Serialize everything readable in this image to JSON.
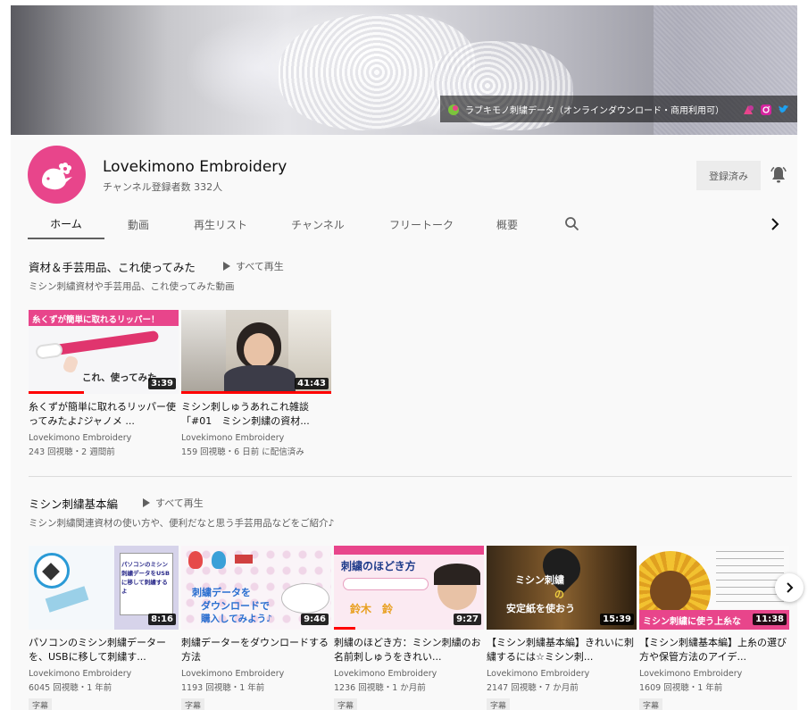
{
  "banner": {
    "link_text": "ラブキモノ刺繍データ（オンラインダウンロード・商用利用可）"
  },
  "channel": {
    "name": "Lovekimono Embroidery",
    "subscribers": "チャンネル登録者数 332人",
    "subscribe_label": "登録済み",
    "avatar_color": "#e8458b"
  },
  "tabs": [
    {
      "label": "ホーム"
    },
    {
      "label": "動画"
    },
    {
      "label": "再生リスト"
    },
    {
      "label": "チャンネル"
    },
    {
      "label": "フリートーク"
    },
    {
      "label": "概要"
    }
  ],
  "sections": [
    {
      "title": "資材＆手芸用品、これ使ってみた",
      "play_all": "すべて再生",
      "description": "ミシン刺繍資材や手芸用品、これ使ってみた動画",
      "videos": [
        {
          "thumb_text": "糸くずが簡単に取れるリッパー！",
          "thumb_text2": "これ、使ってみた",
          "duration": "3:39",
          "progress": 0.37,
          "title": "糸くずが簡単に取れるリッパー使ってみたよ♪ジャノメ ...",
          "channel": "Lovekimono Embroidery",
          "meta": "243 回視聴・2 週間前"
        },
        {
          "duration": "41:43",
          "progress": 1.0,
          "title": "ミシン刺しゅうあれこれ雑談「#01　ミシン刺繍の資材...",
          "channel": "Lovekimono Embroidery",
          "meta": "159 回視聴・6 日前 に配信済み"
        }
      ]
    },
    {
      "title": "ミシン刺繍基本編",
      "play_all": "すべて再生",
      "description": "ミシン刺繍関連資材の使い方や、便利だなと思う手芸用品などをご紹介♪",
      "videos": [
        {
          "thumb_text": "パソコンのミシン刺繍データをUSBに移して刺繍するよ",
          "duration": "8:16",
          "progress": 0,
          "title": "パソコンのミシン刺繍データーを、USBに移して刺繍す...",
          "channel": "Lovekimono Embroidery",
          "meta": "6045 回視聴・1 年前",
          "badge": "字幕"
        },
        {
          "thumb_text": "刺繍データを",
          "thumb_text2": "ダウンロードで",
          "thumb_text3": "購入してみよう♪",
          "duration": "9:46",
          "progress": 0,
          "title": "刺繍データーをダウンロードする方法",
          "channel": "Lovekimono Embroidery",
          "meta": "1193 回視聴・1 年前",
          "badge": "字幕"
        },
        {
          "thumb_text": "刺繍のほどき方",
          "thumb_text2": "鈴木　鈴",
          "duration": "9:27",
          "progress": 0.14,
          "title": "刺繍のほどき方：ミシン刺繍のお名前刺しゅうをきれい...",
          "channel": "Lovekimono Embroidery",
          "meta": "1236 回視聴・1 か月前",
          "badge": "字幕"
        },
        {
          "thumb_text": "ミシン刺繍",
          "thumb_text2": "の",
          "thumb_text3": "安定紙を使おう",
          "duration": "15:39",
          "progress": 0,
          "title": "【ミシン刺繍基本編】きれいに刺繍するには☆ミシン刺...",
          "channel": "Lovekimono Embroidery",
          "meta": "2147 回視聴・7 か月前",
          "badge": "字幕"
        },
        {
          "thumb_text": "ミシン刺繍に使う上糸な",
          "duration": "11:38",
          "progress": 0,
          "title": "【ミシン刺繍基本編】上糸の選び方や保管方法のアイデ...",
          "channel": "Lovekimono Embroidery",
          "meta": "1609 回視聴・1 年前",
          "badge": "字幕"
        }
      ]
    }
  ]
}
